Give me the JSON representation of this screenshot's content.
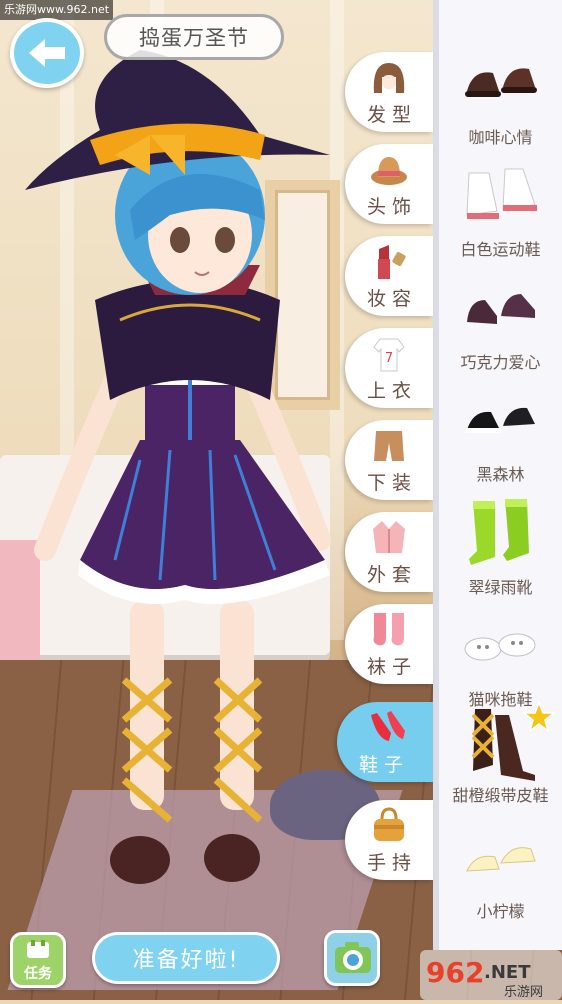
{
  "watermark_top": "乐游网www.962.net",
  "header": {
    "title": "捣蛋万圣节"
  },
  "categories": [
    {
      "label": "发型",
      "icon": "hair-icon"
    },
    {
      "label": "头饰",
      "icon": "hat-icon"
    },
    {
      "label": "妆容",
      "icon": "lipstick-icon"
    },
    {
      "label": "上衣",
      "icon": "shirt-icon"
    },
    {
      "label": "下装",
      "icon": "shorts-icon"
    },
    {
      "label": "外套",
      "icon": "coat-icon"
    },
    {
      "label": "袜子",
      "icon": "socks-icon"
    },
    {
      "label": "鞋子",
      "icon": "heels-icon",
      "active": true
    },
    {
      "label": "手持",
      "icon": "handbag-icon"
    }
  ],
  "items": [
    {
      "label": "咖啡心情",
      "icon": "brown-shoes-icon"
    },
    {
      "label": "白色运动鞋",
      "icon": "white-sneakers-icon"
    },
    {
      "label": "巧克力爱心",
      "icon": "chocolate-loafers-icon"
    },
    {
      "label": "黑森林",
      "icon": "black-shoes-icon"
    },
    {
      "label": "翠绿雨靴",
      "icon": "green-boots-icon"
    },
    {
      "label": "猫咪拖鞋",
      "icon": "cat-slippers-icon"
    },
    {
      "label": "甜橙缎带皮鞋",
      "icon": "ribbon-shoes-icon",
      "starred": true
    },
    {
      "label": "小柠檬",
      "icon": "lemon-flats-icon"
    }
  ],
  "footer": {
    "task_label": "任务",
    "ready_label": "准备好啦!"
  },
  "watermark_logo": {
    "main": "962",
    "suffix": ".NET",
    "sub": "乐游网"
  },
  "colors": {
    "accent": "#76cdee",
    "task_green": "#9ed36a",
    "panel": "#f7f7fb"
  }
}
